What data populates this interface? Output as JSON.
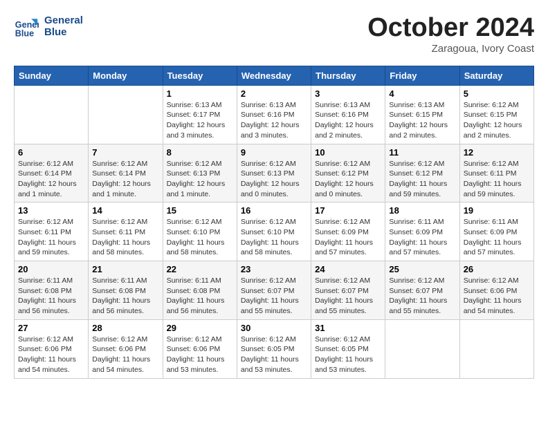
{
  "header": {
    "logo_line1": "General",
    "logo_line2": "Blue",
    "month": "October 2024",
    "location": "Zaragoua, Ivory Coast"
  },
  "weekdays": [
    "Sunday",
    "Monday",
    "Tuesday",
    "Wednesday",
    "Thursday",
    "Friday",
    "Saturday"
  ],
  "weeks": [
    [
      {
        "day": "",
        "info": ""
      },
      {
        "day": "",
        "info": ""
      },
      {
        "day": "1",
        "info": "Sunrise: 6:13 AM\nSunset: 6:17 PM\nDaylight: 12 hours and 3 minutes."
      },
      {
        "day": "2",
        "info": "Sunrise: 6:13 AM\nSunset: 6:16 PM\nDaylight: 12 hours and 3 minutes."
      },
      {
        "day": "3",
        "info": "Sunrise: 6:13 AM\nSunset: 6:16 PM\nDaylight: 12 hours and 2 minutes."
      },
      {
        "day": "4",
        "info": "Sunrise: 6:13 AM\nSunset: 6:15 PM\nDaylight: 12 hours and 2 minutes."
      },
      {
        "day": "5",
        "info": "Sunrise: 6:12 AM\nSunset: 6:15 PM\nDaylight: 12 hours and 2 minutes."
      }
    ],
    [
      {
        "day": "6",
        "info": "Sunrise: 6:12 AM\nSunset: 6:14 PM\nDaylight: 12 hours and 1 minute."
      },
      {
        "day": "7",
        "info": "Sunrise: 6:12 AM\nSunset: 6:14 PM\nDaylight: 12 hours and 1 minute."
      },
      {
        "day": "8",
        "info": "Sunrise: 6:12 AM\nSunset: 6:13 PM\nDaylight: 12 hours and 1 minute."
      },
      {
        "day": "9",
        "info": "Sunrise: 6:12 AM\nSunset: 6:13 PM\nDaylight: 12 hours and 0 minutes."
      },
      {
        "day": "10",
        "info": "Sunrise: 6:12 AM\nSunset: 6:12 PM\nDaylight: 12 hours and 0 minutes."
      },
      {
        "day": "11",
        "info": "Sunrise: 6:12 AM\nSunset: 6:12 PM\nDaylight: 11 hours and 59 minutes."
      },
      {
        "day": "12",
        "info": "Sunrise: 6:12 AM\nSunset: 6:11 PM\nDaylight: 11 hours and 59 minutes."
      }
    ],
    [
      {
        "day": "13",
        "info": "Sunrise: 6:12 AM\nSunset: 6:11 PM\nDaylight: 11 hours and 59 minutes."
      },
      {
        "day": "14",
        "info": "Sunrise: 6:12 AM\nSunset: 6:11 PM\nDaylight: 11 hours and 58 minutes."
      },
      {
        "day": "15",
        "info": "Sunrise: 6:12 AM\nSunset: 6:10 PM\nDaylight: 11 hours and 58 minutes."
      },
      {
        "day": "16",
        "info": "Sunrise: 6:12 AM\nSunset: 6:10 PM\nDaylight: 11 hours and 58 minutes."
      },
      {
        "day": "17",
        "info": "Sunrise: 6:12 AM\nSunset: 6:09 PM\nDaylight: 11 hours and 57 minutes."
      },
      {
        "day": "18",
        "info": "Sunrise: 6:11 AM\nSunset: 6:09 PM\nDaylight: 11 hours and 57 minutes."
      },
      {
        "day": "19",
        "info": "Sunrise: 6:11 AM\nSunset: 6:09 PM\nDaylight: 11 hours and 57 minutes."
      }
    ],
    [
      {
        "day": "20",
        "info": "Sunrise: 6:11 AM\nSunset: 6:08 PM\nDaylight: 11 hours and 56 minutes."
      },
      {
        "day": "21",
        "info": "Sunrise: 6:11 AM\nSunset: 6:08 PM\nDaylight: 11 hours and 56 minutes."
      },
      {
        "day": "22",
        "info": "Sunrise: 6:11 AM\nSunset: 6:08 PM\nDaylight: 11 hours and 56 minutes."
      },
      {
        "day": "23",
        "info": "Sunrise: 6:12 AM\nSunset: 6:07 PM\nDaylight: 11 hours and 55 minutes."
      },
      {
        "day": "24",
        "info": "Sunrise: 6:12 AM\nSunset: 6:07 PM\nDaylight: 11 hours and 55 minutes."
      },
      {
        "day": "25",
        "info": "Sunrise: 6:12 AM\nSunset: 6:07 PM\nDaylight: 11 hours and 55 minutes."
      },
      {
        "day": "26",
        "info": "Sunrise: 6:12 AM\nSunset: 6:06 PM\nDaylight: 11 hours and 54 minutes."
      }
    ],
    [
      {
        "day": "27",
        "info": "Sunrise: 6:12 AM\nSunset: 6:06 PM\nDaylight: 11 hours and 54 minutes."
      },
      {
        "day": "28",
        "info": "Sunrise: 6:12 AM\nSunset: 6:06 PM\nDaylight: 11 hours and 54 minutes."
      },
      {
        "day": "29",
        "info": "Sunrise: 6:12 AM\nSunset: 6:06 PM\nDaylight: 11 hours and 53 minutes."
      },
      {
        "day": "30",
        "info": "Sunrise: 6:12 AM\nSunset: 6:05 PM\nDaylight: 11 hours and 53 minutes."
      },
      {
        "day": "31",
        "info": "Sunrise: 6:12 AM\nSunset: 6:05 PM\nDaylight: 11 hours and 53 minutes."
      },
      {
        "day": "",
        "info": ""
      },
      {
        "day": "",
        "info": ""
      }
    ]
  ]
}
